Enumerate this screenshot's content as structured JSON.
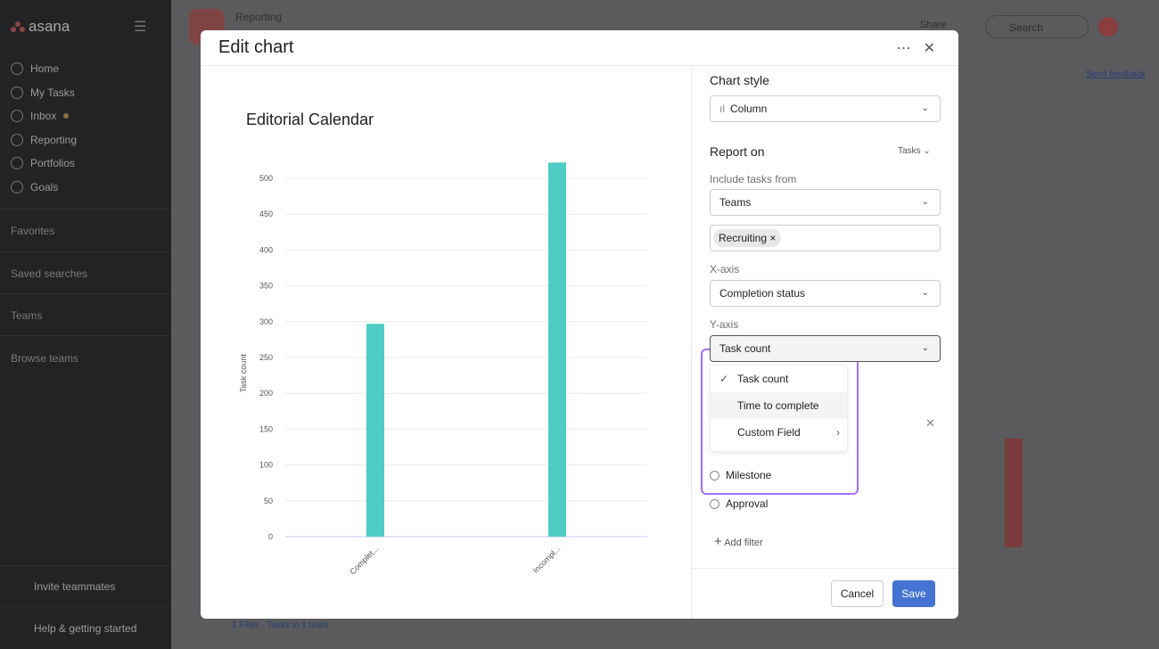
{
  "sidebar": {
    "logo": "asana",
    "items": [
      {
        "label": "Home"
      },
      {
        "label": "My Tasks"
      },
      {
        "label": "Inbox"
      },
      {
        "label": "Reporting"
      },
      {
        "label": "Portfolios"
      },
      {
        "label": "Goals"
      }
    ],
    "sections": [
      "Favorites",
      "Saved searches",
      "Teams",
      "Browse teams"
    ],
    "invite": "Invite teammates",
    "help": "Help & getting started"
  },
  "header": {
    "breadcrumb": "Reporting",
    "share": "Share",
    "search_placeholder": "Search",
    "send_feedback": "Send feedback",
    "filter_summary": "1 Filter · Tasks in 1 team"
  },
  "modal": {
    "title": "Edit chart",
    "panel": {
      "chart_style_label": "Chart style",
      "chart_style": "Column",
      "report_on_label": "Report on",
      "report_on": "Tasks",
      "include_label": "Include tasks from",
      "include": "Teams",
      "tag": "Recruiting",
      "xaxis_label": "X-axis",
      "xaxis": "Completion status",
      "yaxis_label": "Y-axis",
      "yaxis": "Task count",
      "menu": [
        "Task count",
        "Time to complete",
        "Custom Field"
      ],
      "radios": [
        "Milestone",
        "Approval"
      ],
      "add_filter": "Add filter",
      "cancel": "Cancel",
      "save": "Save"
    }
  },
  "chart_data": {
    "type": "bar",
    "title": "Editorial Calendar",
    "ylabel": "Task count",
    "xlabel": "",
    "categories": [
      "Complet...",
      "Incompl..."
    ],
    "values": [
      297,
      522
    ],
    "ylim": [
      0,
      520
    ],
    "yticks": [
      0,
      50,
      100,
      150,
      200,
      250,
      300,
      350,
      400,
      450,
      500
    ],
    "color": "#4ecdc4",
    "grid": true
  }
}
